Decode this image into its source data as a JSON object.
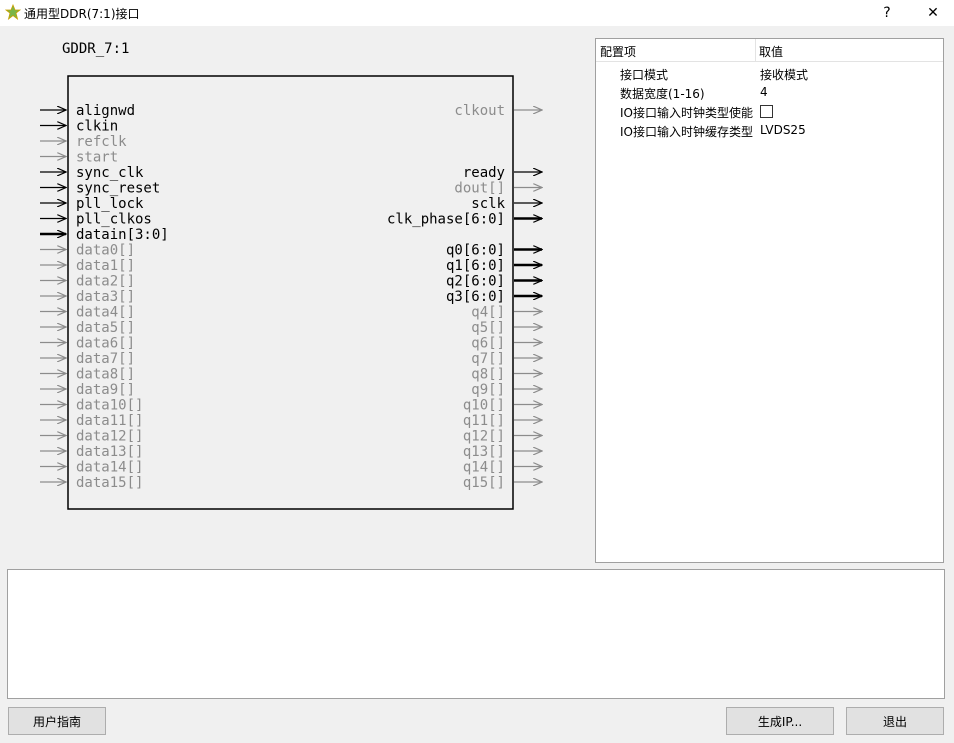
{
  "window": {
    "title": "通用型DDR(7:1)接口",
    "help_label": "?",
    "close_label": "✕"
  },
  "diagram": {
    "block_name": "GDDR_7:1",
    "left_ports": [
      {
        "label": "alignwd",
        "active": true,
        "bus": false
      },
      {
        "label": "clkin",
        "active": true,
        "bus": false
      },
      {
        "label": "refclk",
        "active": false,
        "bus": false
      },
      {
        "label": "start",
        "active": false,
        "bus": false
      },
      {
        "label": "sync_clk",
        "active": true,
        "bus": false
      },
      {
        "label": "sync_reset",
        "active": true,
        "bus": false
      },
      {
        "label": "pll_lock",
        "active": true,
        "bus": false
      },
      {
        "label": "pll_clkos",
        "active": true,
        "bus": false
      },
      {
        "label": "datain[3:0]",
        "active": true,
        "bus": true
      },
      {
        "label": "data0[]",
        "active": false,
        "bus": false
      },
      {
        "label": "data1[]",
        "active": false,
        "bus": false
      },
      {
        "label": "data2[]",
        "active": false,
        "bus": false
      },
      {
        "label": "data3[]",
        "active": false,
        "bus": false
      },
      {
        "label": "data4[]",
        "active": false,
        "bus": false
      },
      {
        "label": "data5[]",
        "active": false,
        "bus": false
      },
      {
        "label": "data6[]",
        "active": false,
        "bus": false
      },
      {
        "label": "data7[]",
        "active": false,
        "bus": false
      },
      {
        "label": "data8[]",
        "active": false,
        "bus": false
      },
      {
        "label": "data9[]",
        "active": false,
        "bus": false
      },
      {
        "label": "data10[]",
        "active": false,
        "bus": false
      },
      {
        "label": "data11[]",
        "active": false,
        "bus": false
      },
      {
        "label": "data12[]",
        "active": false,
        "bus": false
      },
      {
        "label": "data13[]",
        "active": false,
        "bus": false
      },
      {
        "label": "data14[]",
        "active": false,
        "bus": false
      },
      {
        "label": "data15[]",
        "active": false,
        "bus": false
      }
    ],
    "right_ports": [
      {
        "label": "clkout",
        "active": false,
        "bus": false
      },
      null,
      null,
      null,
      {
        "label": "ready",
        "active": true,
        "bus": false
      },
      {
        "label": "dout[]",
        "active": false,
        "bus": false
      },
      {
        "label": "sclk",
        "active": true,
        "bus": false
      },
      {
        "label": "clk_phase[6:0]",
        "active": true,
        "bus": true
      },
      null,
      {
        "label": "q0[6:0]",
        "active": true,
        "bus": true
      },
      {
        "label": "q1[6:0]",
        "active": true,
        "bus": true
      },
      {
        "label": "q2[6:0]",
        "active": true,
        "bus": true
      },
      {
        "label": "q3[6:0]",
        "active": true,
        "bus": true
      },
      {
        "label": "q4[]",
        "active": false,
        "bus": false
      },
      {
        "label": "q5[]",
        "active": false,
        "bus": false
      },
      {
        "label": "q6[]",
        "active": false,
        "bus": false
      },
      {
        "label": "q7[]",
        "active": false,
        "bus": false
      },
      {
        "label": "q8[]",
        "active": false,
        "bus": false
      },
      {
        "label": "q9[]",
        "active": false,
        "bus": false
      },
      {
        "label": "q10[]",
        "active": false,
        "bus": false
      },
      {
        "label": "q11[]",
        "active": false,
        "bus": false
      },
      {
        "label": "q12[]",
        "active": false,
        "bus": false
      },
      {
        "label": "q13[]",
        "active": false,
        "bus": false
      },
      {
        "label": "q14[]",
        "active": false,
        "bus": false
      },
      {
        "label": "q15[]",
        "active": false,
        "bus": false
      }
    ],
    "colors": {
      "active": "#000000",
      "inactive": "#8c8c8c"
    }
  },
  "properties": {
    "header": {
      "item": "配置项",
      "value": "取值"
    },
    "rows": [
      {
        "key": "接口模式",
        "value": "接收模式",
        "type": "text"
      },
      {
        "key": "数据宽度(1-16)",
        "value": "4",
        "type": "text"
      },
      {
        "key": "IO接口输入时钟类型使能",
        "value": "",
        "type": "checkbox"
      },
      {
        "key": "IO接口输入时钟缓存类型",
        "value": "LVDS25",
        "type": "text"
      }
    ]
  },
  "buttons": {
    "guide": "用户指南",
    "generate": "生成IP...",
    "exit": "退出"
  }
}
